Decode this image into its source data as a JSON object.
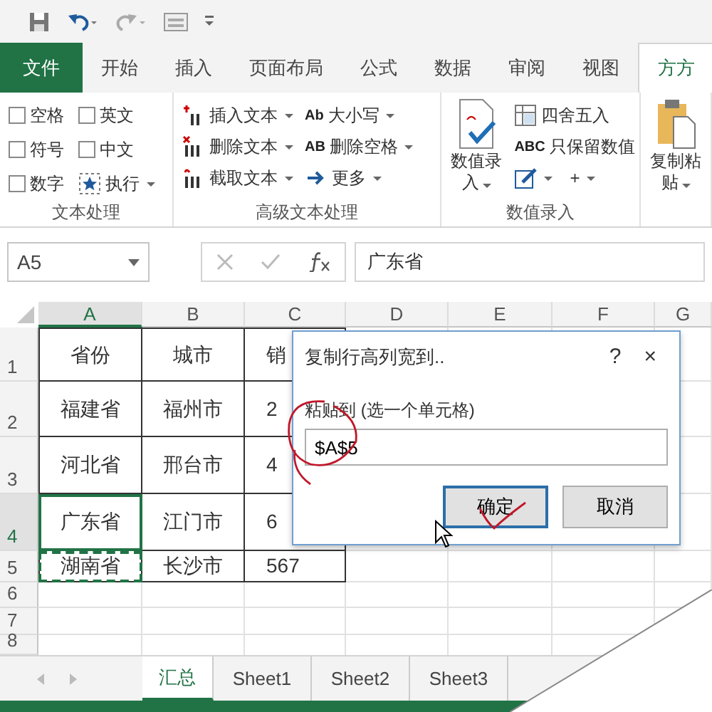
{
  "ribbon_tabs": [
    {
      "label": "文件",
      "kind": "file",
      "selected": false
    },
    {
      "label": "开始",
      "kind": "tab",
      "selected": false
    },
    {
      "label": "插入",
      "kind": "tab",
      "selected": false
    },
    {
      "label": "页面布局",
      "kind": "tab",
      "selected": false
    },
    {
      "label": "公式",
      "kind": "tab",
      "selected": false
    },
    {
      "label": "数据",
      "kind": "tab",
      "selected": false
    },
    {
      "label": "审阅",
      "kind": "tab",
      "selected": false
    },
    {
      "label": "视图",
      "kind": "tab",
      "selected": false
    },
    {
      "label": "方方",
      "kind": "tab",
      "selected": true
    }
  ],
  "ribbon_groups": [
    {
      "label": "文本处理",
      "kind": "checks",
      "items": [
        {
          "kind": "checkbox",
          "label": "空格",
          "checked": false
        },
        {
          "kind": "checkbox",
          "label": "英文",
          "checked": false
        },
        {
          "kind": "checkbox",
          "label": "符号",
          "checked": false
        },
        {
          "kind": "checkbox",
          "label": "中文",
          "checked": false
        },
        {
          "kind": "checkbox",
          "label": "数字",
          "checked": false
        },
        {
          "kind": "menu_button",
          "label": "执行"
        }
      ]
    },
    {
      "label": "高级文本处理",
      "kind": "columns",
      "items": [
        {
          "kind": "menu_button",
          "label": "插入文本"
        },
        {
          "kind": "menu_button",
          "label": "删除文本"
        },
        {
          "kind": "menu_button",
          "label": "截取文本"
        },
        {
          "kind": "menu_button",
          "label": "大小写",
          "icon_text": "Ab"
        },
        {
          "kind": "menu_button",
          "label": "删除空格",
          "icon_text": "AB"
        },
        {
          "kind": "menu_button",
          "label": "更多"
        }
      ]
    },
    {
      "label": "数值录入",
      "kind": "large_first",
      "items": [
        {
          "kind": "large_button",
          "label": "数值录入"
        },
        {
          "kind": "button",
          "label": "四舍五入"
        },
        {
          "kind": "button",
          "label": "只保留数值",
          "icon_text": "ABC"
        },
        {
          "kind": "icon_menu"
        },
        {
          "kind": "menu_button",
          "label": "+"
        }
      ]
    },
    {
      "kind": "large_first",
      "items": [
        {
          "kind": "large_button",
          "label": "复制粘贴"
        }
      ]
    }
  ],
  "name_box": "A5",
  "formula": "广东省",
  "columns": [
    {
      "label": "A",
      "selected": true
    },
    {
      "label": "B",
      "selected": false
    },
    {
      "label": "C",
      "selected": false
    },
    {
      "label": "D",
      "selected": false
    },
    {
      "label": "E",
      "selected": false
    },
    {
      "label": "F",
      "selected": false
    },
    {
      "label": "G",
      "selected": false
    }
  ],
  "rows": [
    {
      "header": "1",
      "selected": false,
      "a_cell": {
        "text": "省份",
        "active": false,
        "marquee": false
      },
      "cells": [
        "城市",
        "销"
      ]
    },
    {
      "header": "2",
      "selected": false,
      "a_cell": {
        "text": "福建省",
        "active": false,
        "marquee": false
      },
      "cells": [
        "福州市",
        "2"
      ]
    },
    {
      "header": "3",
      "selected": false,
      "a_cell": {
        "text": "河北省",
        "active": false,
        "marquee": false
      },
      "cells": [
        "邢台市",
        "4"
      ]
    },
    {
      "header": "4",
      "selected": true,
      "a_cell": {
        "text": "广东省",
        "active": true,
        "marquee": false
      },
      "cells": [
        "江门市",
        "6"
      ]
    },
    {
      "header": "5",
      "selected": false,
      "a_cell": {
        "text": "湖南省",
        "active": false,
        "marquee": true
      },
      "cells": [
        "长沙市",
        "567"
      ]
    },
    {
      "header": "6",
      "selected": false
    },
    {
      "header": "7",
      "selected": false
    },
    {
      "header": "8",
      "selected": false
    }
  ],
  "sheets": [
    {
      "label": "汇总",
      "selected": true
    },
    {
      "label": "Sheet1",
      "selected": false
    },
    {
      "label": "Sheet2",
      "selected": false
    },
    {
      "label": "Sheet3",
      "selected": false
    }
  ],
  "dialog": {
    "title": "复制行高列宽到..",
    "help": "?",
    "close": "×",
    "field_label": "粘贴到 (选一个单元格)",
    "field_value": "$A$5",
    "buttons": [
      {
        "label": "确定",
        "focused": true
      },
      {
        "label": "取消",
        "focused": false
      }
    ]
  }
}
